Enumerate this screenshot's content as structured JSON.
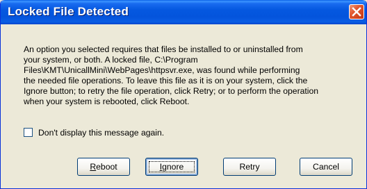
{
  "window": {
    "title": "Locked File Detected"
  },
  "message": {
    "lines": [
      "An option you selected requires that files be installed to or uninstalled from",
      "your system, or both. A locked file, C:\\Program",
      "Files\\KMT\\UnicallMini\\WebPages\\httpsvr.exe, was found while performing",
      "the needed file operations. To leave this file as it is on your system, click the",
      "Ignore button; to retry the file operation, click Retry; or to perform the operation",
      "when your system is rebooted, click Reboot."
    ]
  },
  "checkbox": {
    "label": "Don't display this message again.",
    "checked": false
  },
  "buttons": {
    "reboot": {
      "label_first": "R",
      "label_rest": "eboot"
    },
    "ignore": {
      "label_first": "I",
      "label_rest": "gnore"
    },
    "retry": {
      "label": "Retry"
    },
    "cancel": {
      "label": "Cancel"
    }
  },
  "icons": {
    "close": "close-icon"
  },
  "colors": {
    "titlebar": "#0558e0",
    "close_button": "#e2582f",
    "dialog_background": "#ece9d8"
  }
}
